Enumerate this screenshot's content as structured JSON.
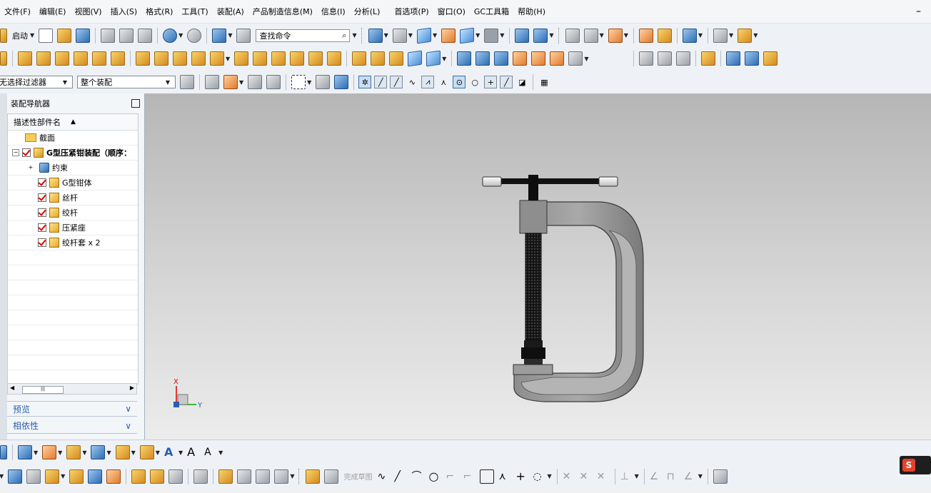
{
  "menu": [
    "文件(F)",
    "编辑(E)",
    "视图(V)",
    "插入(S)",
    "格式(R)",
    "工具(T)",
    "装配(A)",
    "产品制造信息(M)",
    "信息(I)",
    "分析(L)",
    "首选项(P)",
    "窗口(O)",
    "GC工具箱",
    "帮助(H)"
  ],
  "toolbar": {
    "start_label": "启动",
    "search_placeholder": "查找命令"
  },
  "selection": {
    "filter_value": "无选择过滤器",
    "scope_value": "整个装配"
  },
  "navigator": {
    "title": "装配导航器",
    "column_header": "描述性部件名",
    "items": [
      {
        "label": "截面",
        "type": "folder"
      },
      {
        "label": "G型压紧钳装配（顺序：",
        "type": "assembly"
      },
      {
        "label": "约束",
        "type": "constraints"
      },
      {
        "label": "G型钳体",
        "type": "part"
      },
      {
        "label": "丝杆",
        "type": "part"
      },
      {
        "label": "绞杆",
        "type": "part"
      },
      {
        "label": "压紧座",
        "type": "part"
      },
      {
        "label": "绞杆套 x 2",
        "type": "part"
      }
    ],
    "panels": [
      "预览",
      "相依性"
    ]
  },
  "triad": {
    "x": "X",
    "y": "Y"
  },
  "sketch": {
    "finish_label": "完成草图"
  },
  "colors": {
    "viewport_top": "#b6b6b6",
    "viewport_bottom": "#ececec",
    "accent": "#2a5fb0",
    "check": "#dd0000"
  }
}
